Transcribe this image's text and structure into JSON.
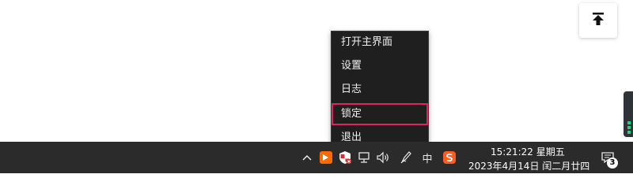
{
  "context_menu": {
    "items": [
      {
        "label": "打开主界面"
      },
      {
        "label": "设置"
      },
      {
        "label": "日志"
      },
      {
        "label": "锁定"
      },
      {
        "label": "退出"
      }
    ],
    "selected_item": "锁定"
  },
  "taskbar": {
    "ime_label": "中",
    "clock": {
      "time": "15:21:22 星期五",
      "date": "2023年4月14日 闰二月廿四"
    },
    "notifications": {
      "count": "3"
    }
  },
  "colors": {
    "taskbar": "#2b2b2b",
    "menu_background": "#1f1f1f",
    "menu_highlight": "#e0245e",
    "app_icon_orange": "#ff6a00",
    "sogou_orange": "#ff5a1f",
    "widget_green": "#1fd37a"
  }
}
